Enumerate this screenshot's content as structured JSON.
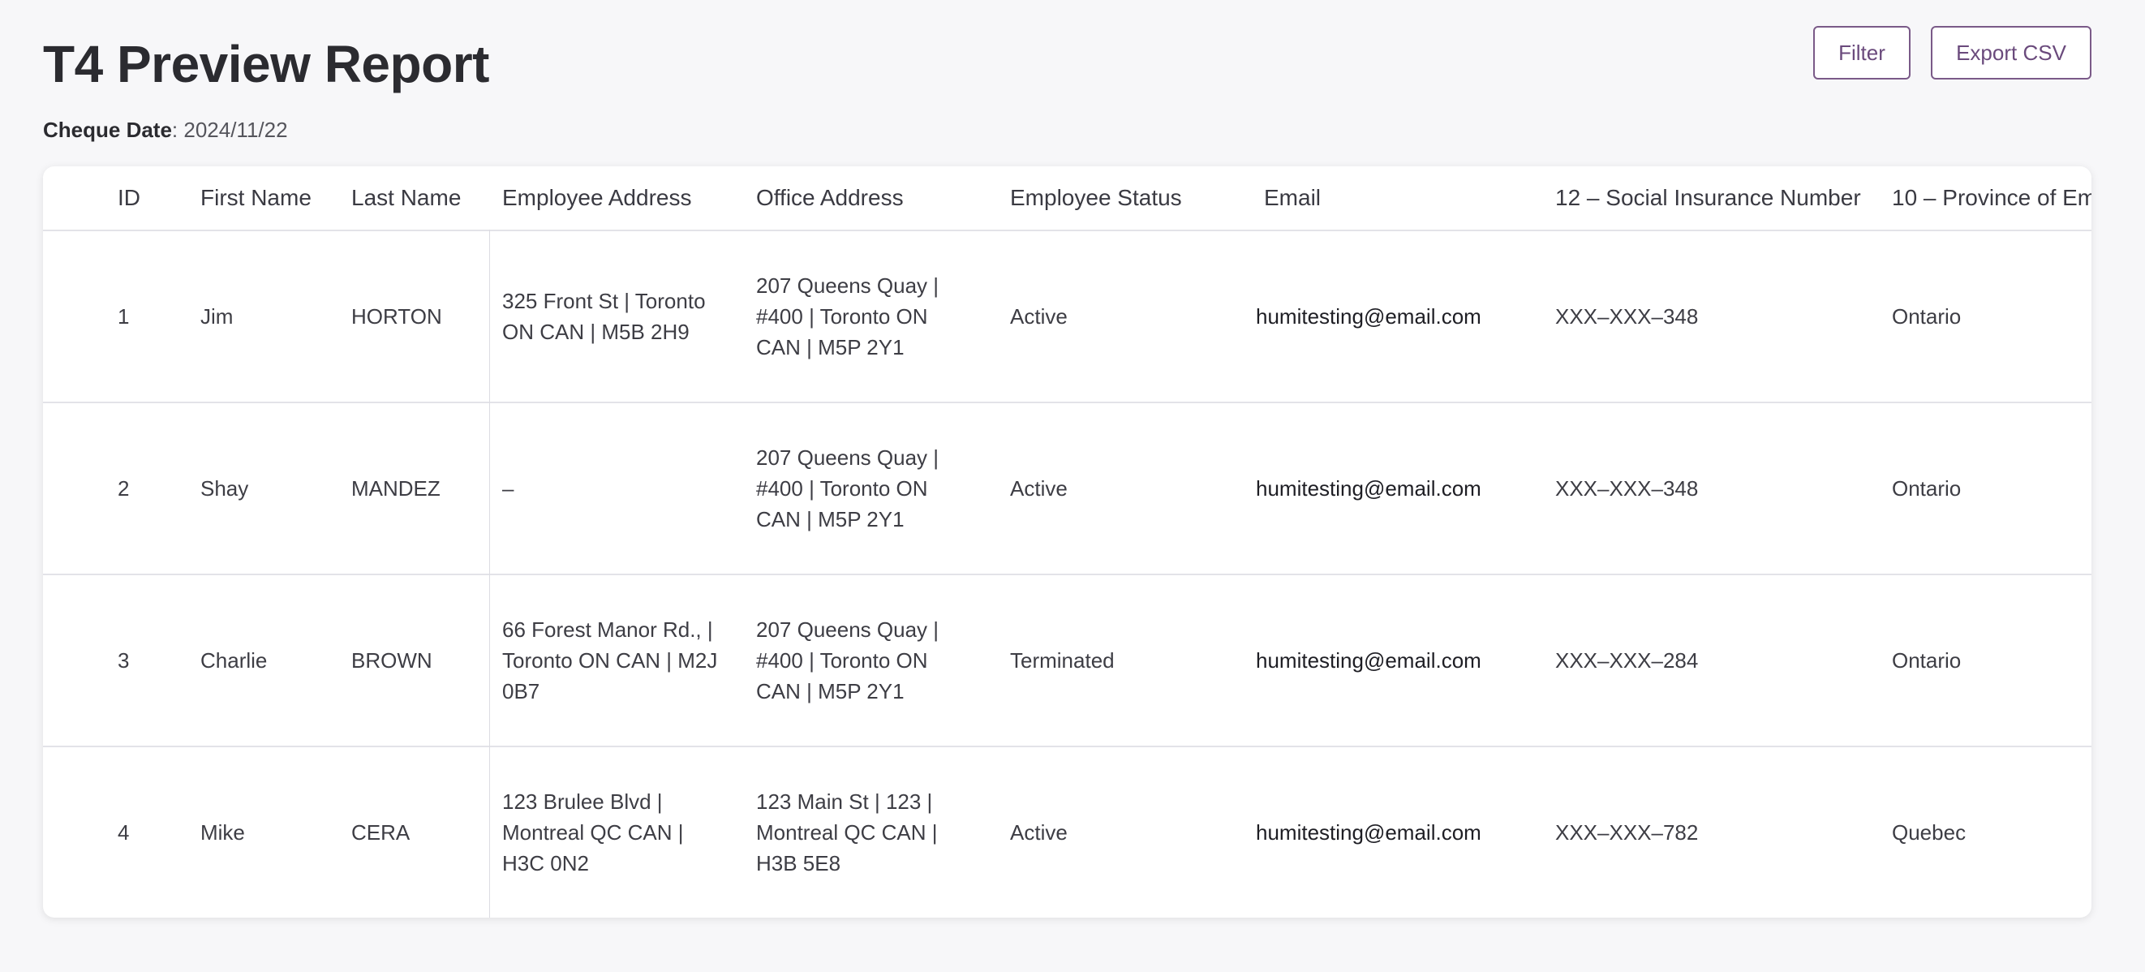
{
  "header": {
    "title": "T4 Preview Report",
    "cheque_label": "Cheque Date",
    "cheque_value": ": 2024/11/22",
    "filter_label": "Filter",
    "export_label": "Export CSV"
  },
  "table": {
    "columns": [
      "ID",
      "First Name",
      "Last Name",
      "Employee Address",
      "Office Address",
      "Employee Status",
      "Email",
      "12 – Social Insurance Number",
      "10 – Province of Em"
    ],
    "rows": [
      {
        "id": "1",
        "first": "Jim",
        "last": "HORTON",
        "employee_address": "325 Front St | Toronto ON CAN | M5B 2H9",
        "office_address": "207 Queens Quay | #400 | Toronto ON CAN | M5P 2Y1",
        "status": "Active",
        "email": "humitesting@email.com",
        "sin": "XXX–XXX–348",
        "province": "Ontario"
      },
      {
        "id": "2",
        "first": "Shay",
        "last": "MANDEZ",
        "employee_address": "–",
        "office_address": "207 Queens Quay | #400 | Toronto ON CAN | M5P 2Y1",
        "status": "Active",
        "email": "humitesting@email.com",
        "sin": "XXX–XXX–348",
        "province": "Ontario"
      },
      {
        "id": "3",
        "first": "Charlie",
        "last": "BROWN",
        "employee_address": "66 Forest Manor Rd., | Toronto ON CAN | M2J 0B7",
        "office_address": "207 Queens Quay | #400 | Toronto ON CAN | M5P 2Y1",
        "status": "Terminated",
        "email": "humitesting@email.com",
        "sin": "XXX–XXX–284",
        "province": "Ontario"
      },
      {
        "id": "4",
        "first": "Mike",
        "last": "CERA",
        "employee_address": "123 Brulee Blvd | Montreal QC CAN | H3C 0N2",
        "office_address": "123 Main St | 123 | Montreal QC CAN | H3B 5E8",
        "status": "Active",
        "email": "humitesting@email.com",
        "sin": "XXX–XXX–782",
        "province": "Quebec"
      }
    ]
  },
  "colors": {
    "accent": "#7a5a88",
    "background": "#f7f7f9"
  }
}
